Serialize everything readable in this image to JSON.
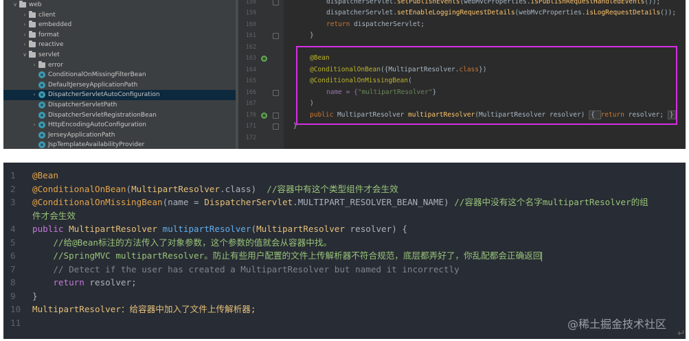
{
  "tree": {
    "rows": [
      {
        "label": "web",
        "kind": "folder",
        "chev": "∨",
        "indent": 0,
        "selected": false
      },
      {
        "label": "client",
        "kind": "folder",
        "chev": "›",
        "indent": 1,
        "selected": false
      },
      {
        "label": "embedded",
        "kind": "folder",
        "chev": "›",
        "indent": 1,
        "selected": false
      },
      {
        "label": "format",
        "kind": "folder",
        "chev": "›",
        "indent": 1,
        "selected": false
      },
      {
        "label": "reactive",
        "kind": "folder",
        "chev": "›",
        "indent": 1,
        "selected": false
      },
      {
        "label": "servlet",
        "kind": "folder",
        "chev": "∨",
        "indent": 1,
        "selected": false
      },
      {
        "label": "error",
        "kind": "folder",
        "chev": "›",
        "indent": 2,
        "selected": false
      },
      {
        "label": "ConditionalOnMissingFilterBean",
        "kind": "class",
        "chev": "",
        "indent": 2,
        "selected": false
      },
      {
        "label": "DefaultJerseyApplicationPath",
        "kind": "class",
        "chev": "",
        "indent": 2,
        "selected": false
      },
      {
        "label": "DispatcherServletAutoConfiguration",
        "kind": "class",
        "chev": "›",
        "indent": 2,
        "selected": true
      },
      {
        "label": "DispatcherServletPath",
        "kind": "class",
        "chev": "",
        "indent": 2,
        "selected": false
      },
      {
        "label": "DispatcherServletRegistrationBean",
        "kind": "class",
        "chev": "",
        "indent": 2,
        "selected": false
      },
      {
        "label": "HttpEncodingAutoConfiguration",
        "kind": "class",
        "chev": "›",
        "indent": 2,
        "selected": false
      },
      {
        "label": "JerseyApplicationPath",
        "kind": "class",
        "chev": "",
        "indent": 2,
        "selected": false
      },
      {
        "label": "JspTemplateAvailabilityProvider",
        "kind": "class",
        "chev": "",
        "indent": 2,
        "selected": false
      }
    ]
  },
  "editor": {
    "line_numbers": [
      "158",
      "159",
      "160",
      "161",
      "162",
      "163",
      "164",
      "165",
      "166",
      "167",
      "170",
      "171",
      "172"
    ],
    "lines": [
      [
        {
          "t": "dispatcherServlet.",
          "c": ""
        },
        {
          "t": "setPublishEvents",
          "c": "fn"
        },
        {
          "t": "(webMvcProperties.",
          "c": ""
        },
        {
          "t": "isPublishRequestHandledEvents",
          "c": "fn"
        },
        {
          "t": "());",
          "c": ""
        }
      ],
      [
        {
          "t": "dispatcherServlet.",
          "c": ""
        },
        {
          "t": "setEnableLoggingRequestDetails",
          "c": "fn"
        },
        {
          "t": "(webMvcProperties.",
          "c": ""
        },
        {
          "t": "isLogRequestDetails",
          "c": "fn"
        },
        {
          "t": "());",
          "c": ""
        }
      ],
      [
        {
          "t": "return ",
          "c": "kw"
        },
        {
          "t": "dispatcherServlet;",
          "c": ""
        }
      ],
      [
        {
          "t": "}",
          "c": ""
        }
      ],
      [],
      [
        {
          "t": "@Bean",
          "c": "ann"
        }
      ],
      [
        {
          "t": "@ConditionalOnBean",
          "c": "ann"
        },
        {
          "t": "({",
          "c": ""
        },
        {
          "t": "MultipartResolver",
          "c": ""
        },
        {
          "t": ".",
          "c": ""
        },
        {
          "t": "class",
          "c": "kw"
        },
        {
          "t": "})",
          "c": ""
        }
      ],
      [
        {
          "t": "@ConditionalOnMissingBean",
          "c": "ann"
        },
        {
          "t": "(",
          "c": ""
        }
      ],
      [
        {
          "t": "name = {",
          "c": "purple"
        },
        {
          "t": "\"multipartResolver\"",
          "c": "str"
        },
        {
          "t": "}",
          "c": ""
        }
      ],
      [
        {
          "t": ")",
          "c": ""
        }
      ],
      [
        {
          "t": "public ",
          "c": "kw"
        },
        {
          "t": "MultipartResolver ",
          "c": ""
        },
        {
          "t": "multipartResolver",
          "c": "fn"
        },
        {
          "t": "(MultipartResolver resolver) ",
          "c": ""
        },
        {
          "t": "{ ",
          "c": "box"
        },
        {
          "t": "return ",
          "c": "kw"
        },
        {
          "t": "resolver; ",
          "c": ""
        },
        {
          "t": "}",
          "c": "box"
        }
      ],
      [
        {
          "t": "}",
          "c": ""
        }
      ],
      []
    ]
  },
  "code": {
    "lines": [
      {
        "n": "1",
        "parts": [
          {
            "t": "@Bean",
            "c": "ann"
          }
        ]
      },
      {
        "n": "2",
        "parts": [
          {
            "t": "@ConditionalOnBean",
            "c": "ann"
          },
          {
            "t": "(",
            "c": "plain"
          },
          {
            "t": "MultipartResolver",
            "c": "type"
          },
          {
            "t": ".class)  ",
            "c": "plain"
          },
          {
            "t": "//容器中有这个类型组件才会生效",
            "c": "cmt"
          }
        ]
      },
      {
        "n": "3",
        "parts": [
          {
            "t": "@ConditionalOnMissingBean",
            "c": "ann"
          },
          {
            "t": "(name = ",
            "c": "plain"
          },
          {
            "t": "DispatcherServlet",
            "c": "type"
          },
          {
            "t": ".MULTIPART_RESOLVER_BEAN_NAME) ",
            "c": "plain"
          },
          {
            "t": "//容器中没有这个名字multipartResolver的组",
            "c": "cmt"
          }
        ]
      },
      {
        "n": "",
        "parts": [
          {
            "t": "件才会生效",
            "c": "cmt"
          }
        ]
      },
      {
        "n": "4",
        "parts": [
          {
            "t": "public ",
            "c": "kw"
          },
          {
            "t": "MultipartResolver ",
            "c": "type"
          },
          {
            "t": "multipartResolver",
            "c": "fn"
          },
          {
            "t": "(",
            "c": "plain"
          },
          {
            "t": "MultipartResolver",
            "c": "type"
          },
          {
            "t": " resolver) {",
            "c": "plain"
          }
        ]
      },
      {
        "n": "5",
        "parts": [
          {
            "t": "    //给@Bean标注的方法传入了对象参数，这个参数的值就会从容器中找。",
            "c": "cmt"
          }
        ]
      },
      {
        "n": "6",
        "parts": [
          {
            "t": "    //SpringMVC multipartResolver。防止有些用户配置的文件上传解析器不符合规范，底层都弄好了，你乱配都会正确返回",
            "c": "cmt"
          },
          {
            "t": "",
            "c": "cursor"
          }
        ]
      },
      {
        "n": "7",
        "parts": [
          {
            "t": "    // Detect if the user has created a MultipartResolver but named it incorrectly",
            "c": "gray"
          }
        ]
      },
      {
        "n": "8",
        "parts": [
          {
            "t": "    ",
            "c": "plain"
          },
          {
            "t": "return ",
            "c": "kw"
          },
          {
            "t": "resolver;",
            "c": "plain"
          }
        ]
      },
      {
        "n": "9",
        "parts": [
          {
            "t": "}",
            "c": "plain"
          }
        ]
      },
      {
        "n": "10",
        "parts": [
          {
            "t": "MultipartResolver",
            "c": "type"
          },
          {
            "t": "：给容器中加入了文件上传解析器;",
            "c": "yel"
          }
        ]
      },
      {
        "n": "11",
        "parts": []
      }
    ]
  },
  "watermark": "@稀土掘金技术社区",
  "enter_mark": "↵"
}
